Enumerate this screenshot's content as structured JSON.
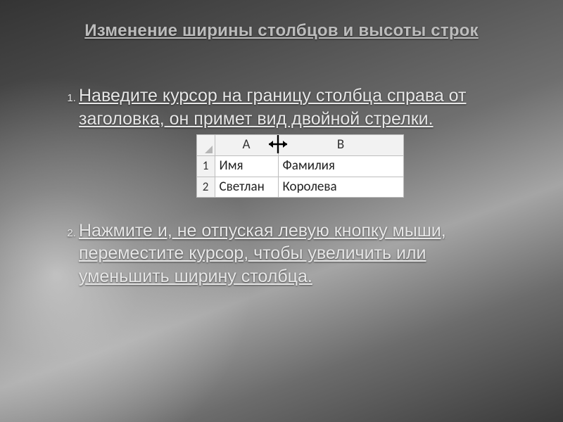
{
  "title": "Изменение ширины столбцов и высоты строк",
  "step1": "Наведите курсор на границу столбца справа от заголовка, он примет вид двойной стрелки.",
  "step2": "Нажмите и, не отпуская левую кнопку мыши, переместите курсор, чтобы увеличить или уменьшить ширину столбца.",
  "chart_data": {
    "type": "table",
    "columns": [
      "A",
      "B"
    ],
    "rows": [
      {
        "n": "1",
        "a": "Имя",
        "b": "Фамилия"
      },
      {
        "n": "2",
        "a": "Светлан",
        "b": "Королева"
      }
    ],
    "note": "resize-cursor between columns A and B"
  }
}
